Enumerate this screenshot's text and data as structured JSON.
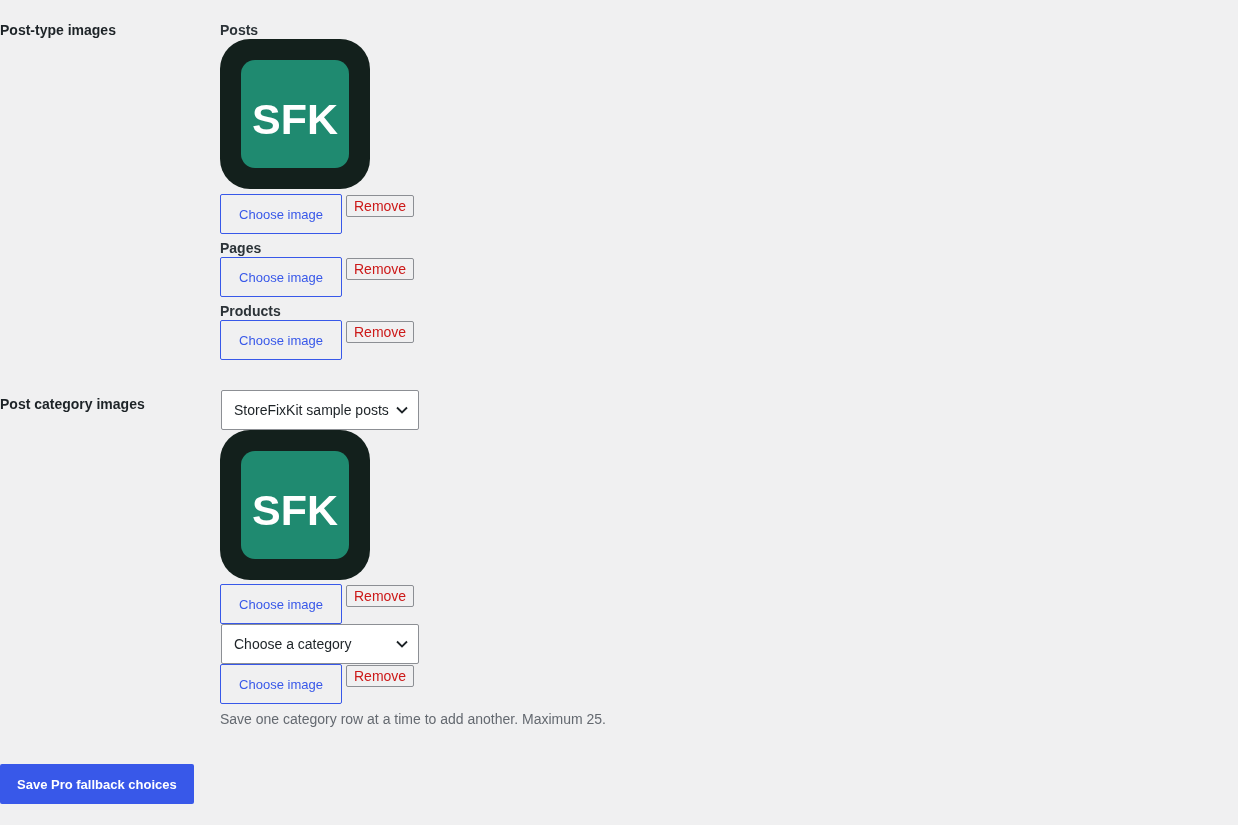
{
  "sections": [
    {
      "kind": "post_types",
      "label": "Post-type images",
      "items": [
        {
          "label": "Posts",
          "image": {
            "text": "SFK"
          },
          "choose_button": "Choose image",
          "remove_button": "Remove"
        },
        {
          "label": "Pages",
          "choose_button": "Choose image",
          "remove_button": "Remove"
        },
        {
          "label": "Products",
          "choose_button": "Choose image",
          "remove_button": "Remove"
        }
      ]
    },
    {
      "kind": "categories",
      "label": "Post category images",
      "items": [
        {
          "category": "StoreFixKit sample posts",
          "image": {
            "text": "SFK"
          },
          "choose_button": "Choose image",
          "remove_button": "Remove"
        },
        {
          "category": "Choose a category",
          "choose_button": "Choose image",
          "remove_button": "Remove"
        }
      ],
      "note": "Save one category row at a time to add another. Maximum 25."
    }
  ],
  "save_button": "Save Pro fallback choices"
}
